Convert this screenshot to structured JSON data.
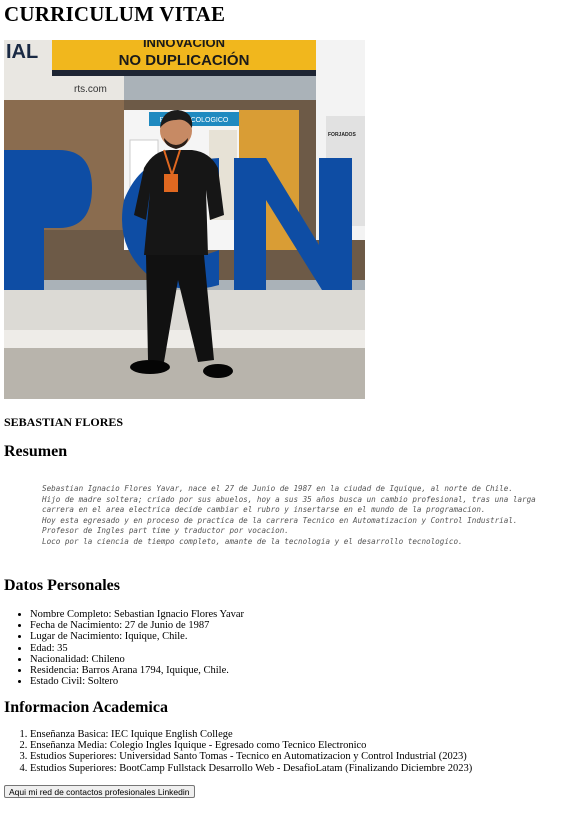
{
  "page": {
    "title": "CURRICULUM VITAE",
    "name": "SEBASTIAN FLORES"
  },
  "photo": {
    "banner_line1": "INNOVACIÓN",
    "banner_line2": "NO DUPLICACIÓN",
    "left_sign": "IAL",
    "left_sign2": "rts.com",
    "booth_sign": "PUNTO ECOLOGICO",
    "right_sign": "FORJADOS",
    "big_letters": "PCN",
    "colors": {
      "sky": "#9ea7ad",
      "banner": "#f1b71d",
      "letters": "#0e4da4",
      "floor": "#c9c6bf"
    }
  },
  "resumen": {
    "heading": "Resumen",
    "lines": [
      "Sebastian Ignacio Flores Yavar, nace el 27 de Junio de 1987 en la ciudad de Iquique, al norte de Chile.",
      "Hijo de madre soltera; criado por sus abuelos, hoy a sus 35 años busca un cambio profesional, tras una larga",
      "carrera en el area electrica decide cambiar el rubro y insertarse en el mundo de la programacion.",
      "Hoy esta egresado y en proceso de practica de la carrera Tecnico en Automatizacion y Control Industrial.",
      "Profesor de Ingles part time y traductor por vocacion.",
      "Loco por la ciencia de tiempo completo, amante de la tecnologia y el desarrollo tecnologico."
    ]
  },
  "datos": {
    "heading": "Datos Personales",
    "items": [
      "Nombre Completo: Sebastian Ignacio Flores Yavar",
      "Fecha de Nacimiento: 27 de Junio de 1987",
      "Lugar de Nacimiento: Iquique, Chile.",
      "Edad: 35",
      "Nacionalidad: Chileno",
      "Residencia: Barros Arana 1794, Iquique, Chile.",
      "Estado Civil: Soltero"
    ]
  },
  "academica": {
    "heading": "Informacion Academica",
    "items": [
      "Enseñanza Basica: IEC Iquique English College",
      "Enseñanza Media: Colegio Ingles Iquique - Egresado como Tecnico Electronico",
      "Estudios Superiores: Universidad Santo Tomas - Tecnico en Automatizacion y Control Industrial (2023)",
      "Estudios Superiores: BootCamp Fullstack Desarrollo Web - DesafioLatam (Finalizando Diciembre 2023)"
    ]
  },
  "linkedin_button": "Aqui mi red de contactos profesionales Linkedin"
}
